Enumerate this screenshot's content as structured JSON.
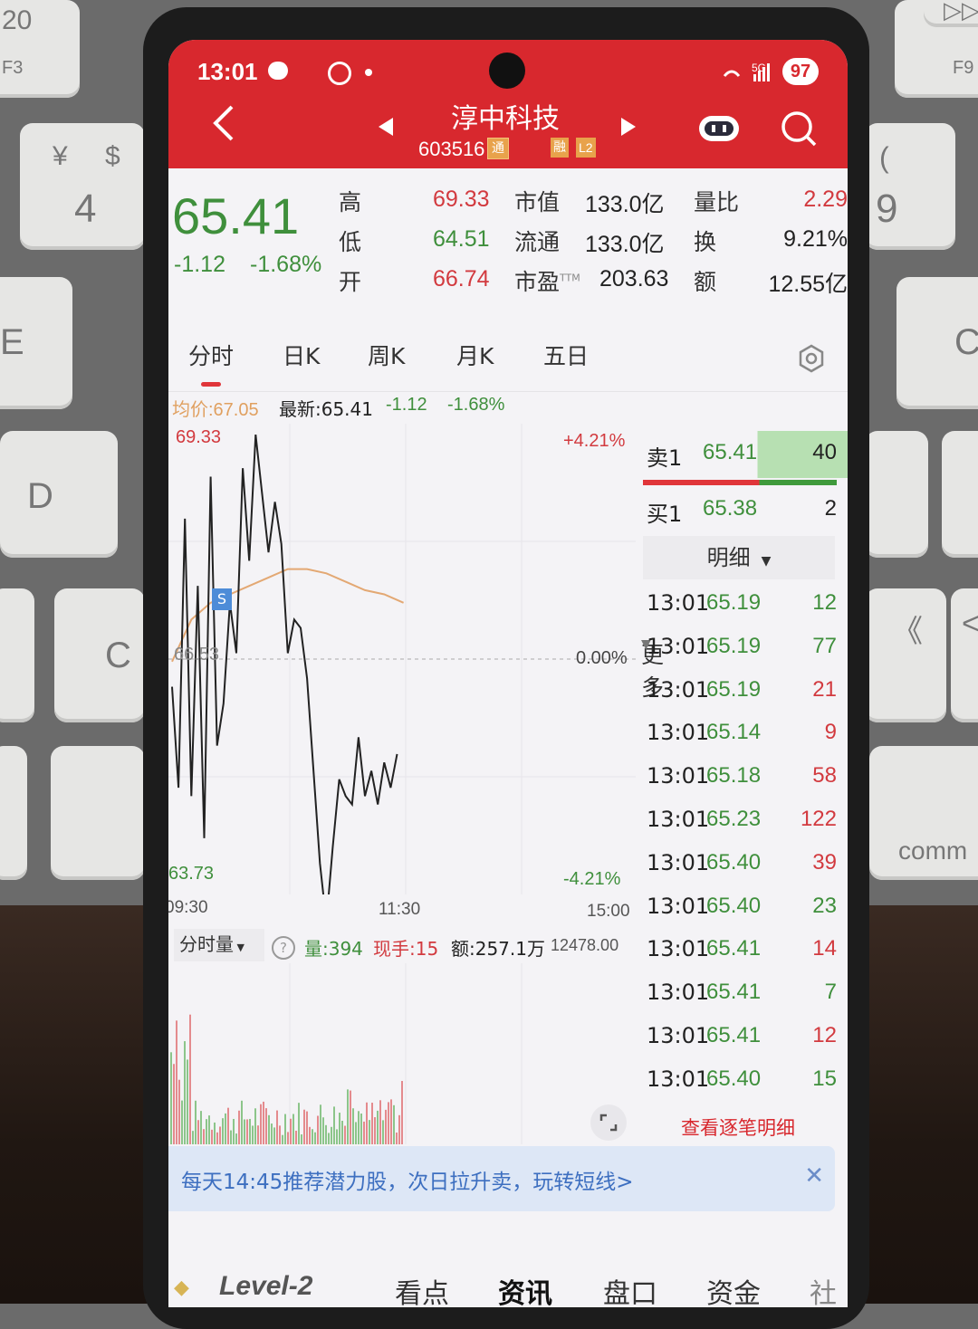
{
  "status_bar": {
    "time": "13:01",
    "battery": "97",
    "net": "5G"
  },
  "header": {
    "title": "淳中科技",
    "code": "603516",
    "badge_tong": "通",
    "badge_rong": "融",
    "badge_l2": "L2"
  },
  "quote": {
    "price": "65.41",
    "change": "-1.12",
    "change_pct": "-1.68%",
    "high_label": "高",
    "high": "69.33",
    "low_label": "低",
    "low": "64.51",
    "open_label": "开",
    "open": "66.74",
    "mktcap_label": "市值",
    "mktcap": "133.0亿",
    "float_label": "流通",
    "float": "133.0亿",
    "pe_label": "市盈",
    "pe_sup": "TTM",
    "pe": "203.63",
    "vr_label": "量比",
    "vr": "2.29",
    "turnover_label": "换",
    "turnover": "9.21%",
    "amount_label": "额",
    "amount": "12.55亿"
  },
  "tabs": [
    "分时",
    "日K",
    "周K",
    "月K",
    "五日",
    "更多"
  ],
  "info_line": {
    "avg": "均价:67.05",
    "latest": "最新:65.41",
    "chg": "-1.12",
    "pct": "-1.68%"
  },
  "chart_labels": {
    "top_price": "69.33",
    "top_pct": "+4.21%",
    "mid_price": "66.53",
    "mid_pct": "0.00%",
    "bot_price": "63.73",
    "bot_pct": "-4.21%",
    "t_start": "09:30",
    "t_mid": "11:30",
    "t_end": "15:00",
    "marker": "S"
  },
  "chart_data": {
    "type": "line",
    "series": [
      {
        "values": [
          66.2,
          65.0,
          68.2,
          64.9,
          67.4,
          64.4,
          68.7,
          65.5,
          66.0,
          67.2,
          66.6,
          68.8,
          67.7,
          69.2,
          68.5,
          67.8,
          68.4,
          67.9,
          66.6,
          67.0,
          66.9,
          66.3,
          65.2,
          64.1,
          63.4,
          64.3,
          65.1,
          64.9,
          64.8,
          65.6,
          64.9,
          65.2,
          64.8,
          65.3,
          65.0,
          65.4
        ]
      },
      {
        "values": [
          66.5,
          67.0,
          67.2,
          67.3,
          67.4,
          67.5,
          67.6,
          67.6,
          67.55,
          67.45,
          67.35,
          67.3,
          67.2
        ]
      }
    ],
    "ylim": [
      63.73,
      69.33
    ]
  },
  "volume_bar": {
    "label": "分时量",
    "vol": "量:394",
    "hand": "现手:15",
    "amt": "额:257.1万",
    "max": "12478.00"
  },
  "order_book": {
    "sell_label": "卖1",
    "sell_price": "65.41",
    "sell_vol": "40",
    "buy_label": "买1",
    "buy_price": "65.38",
    "buy_vol": "2",
    "detail_label": "明细"
  },
  "trades": [
    {
      "t": "13:01",
      "p": "65.19",
      "v": "12",
      "c": "green"
    },
    {
      "t": "13:01",
      "p": "65.19",
      "v": "77",
      "c": "green"
    },
    {
      "t": "13:01",
      "p": "65.19",
      "v": "21",
      "c": "red"
    },
    {
      "t": "13:01",
      "p": "65.14",
      "v": "9",
      "c": "red"
    },
    {
      "t": "13:01",
      "p": "65.18",
      "v": "58",
      "c": "red"
    },
    {
      "t": "13:01",
      "p": "65.23",
      "v": "122",
      "c": "red"
    },
    {
      "t": "13:01",
      "p": "65.40",
      "v": "39",
      "c": "red"
    },
    {
      "t": "13:01",
      "p": "65.40",
      "v": "23",
      "c": "green"
    },
    {
      "t": "13:01",
      "p": "65.41",
      "v": "14",
      "c": "red"
    },
    {
      "t": "13:01",
      "p": "65.41",
      "v": "7",
      "c": "green"
    },
    {
      "t": "13:01",
      "p": "65.41",
      "v": "12",
      "c": "red"
    },
    {
      "t": "13:01",
      "p": "65.40",
      "v": "15",
      "c": "green"
    }
  ],
  "view_all": "查看逐笔明细",
  "banner": "每天14:45推荐潜力股，次日拉升卖，玩转短线>",
  "bottom_tabs": [
    "Level-2",
    "看点",
    "资讯",
    "盘口",
    "资金",
    "社"
  ],
  "keyboard": {
    "k_f3": "F3",
    "k_yen": "¥",
    "k_dollar": "$",
    "k_4": "4",
    "k_d": "D",
    "k_c": "C",
    "k_e": "E",
    "k_20": "20",
    "k_f9": "F9",
    "k_9": "9",
    "k_paren": "(",
    "k_cbig": "C",
    "k_comma": "《",
    "k_lt": "<",
    "k_comm": "comm",
    "k_play": "▷▷"
  }
}
